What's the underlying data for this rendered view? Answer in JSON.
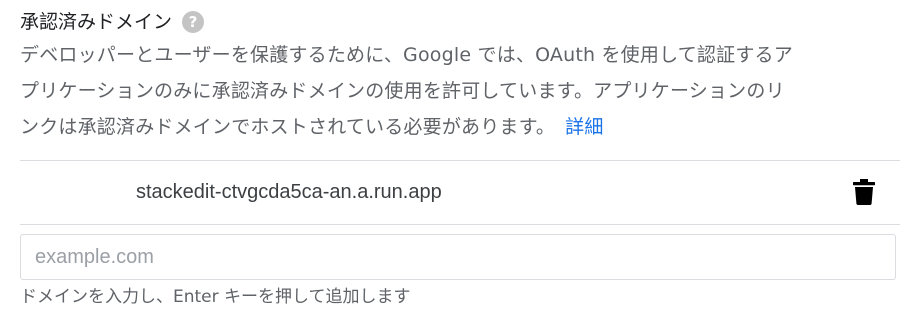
{
  "section": {
    "title": "承認済みドメイン",
    "help_icon": "help-icon",
    "help_glyph": "?",
    "description_lines": [
      "デベロッパーとユーザーを保護するために、Google では、OAuth を使用して認証するア",
      "プリケーションのみに承認済みドメインの使用を許可しています。アプリケーションのリ",
      "ンクは承認済みドメインでホストされている必要があります。"
    ],
    "learn_more_label": "詳細",
    "link_color": "#1a73e8"
  },
  "domains": [
    {
      "name": "stackedit-ctvgcda5ca-an.a.run.app",
      "delete_icon": "trash-icon"
    }
  ],
  "new_domain_input": {
    "value": "",
    "placeholder": "example.com"
  },
  "hint": "ドメインを入力し、Enter キーを押して追加します"
}
